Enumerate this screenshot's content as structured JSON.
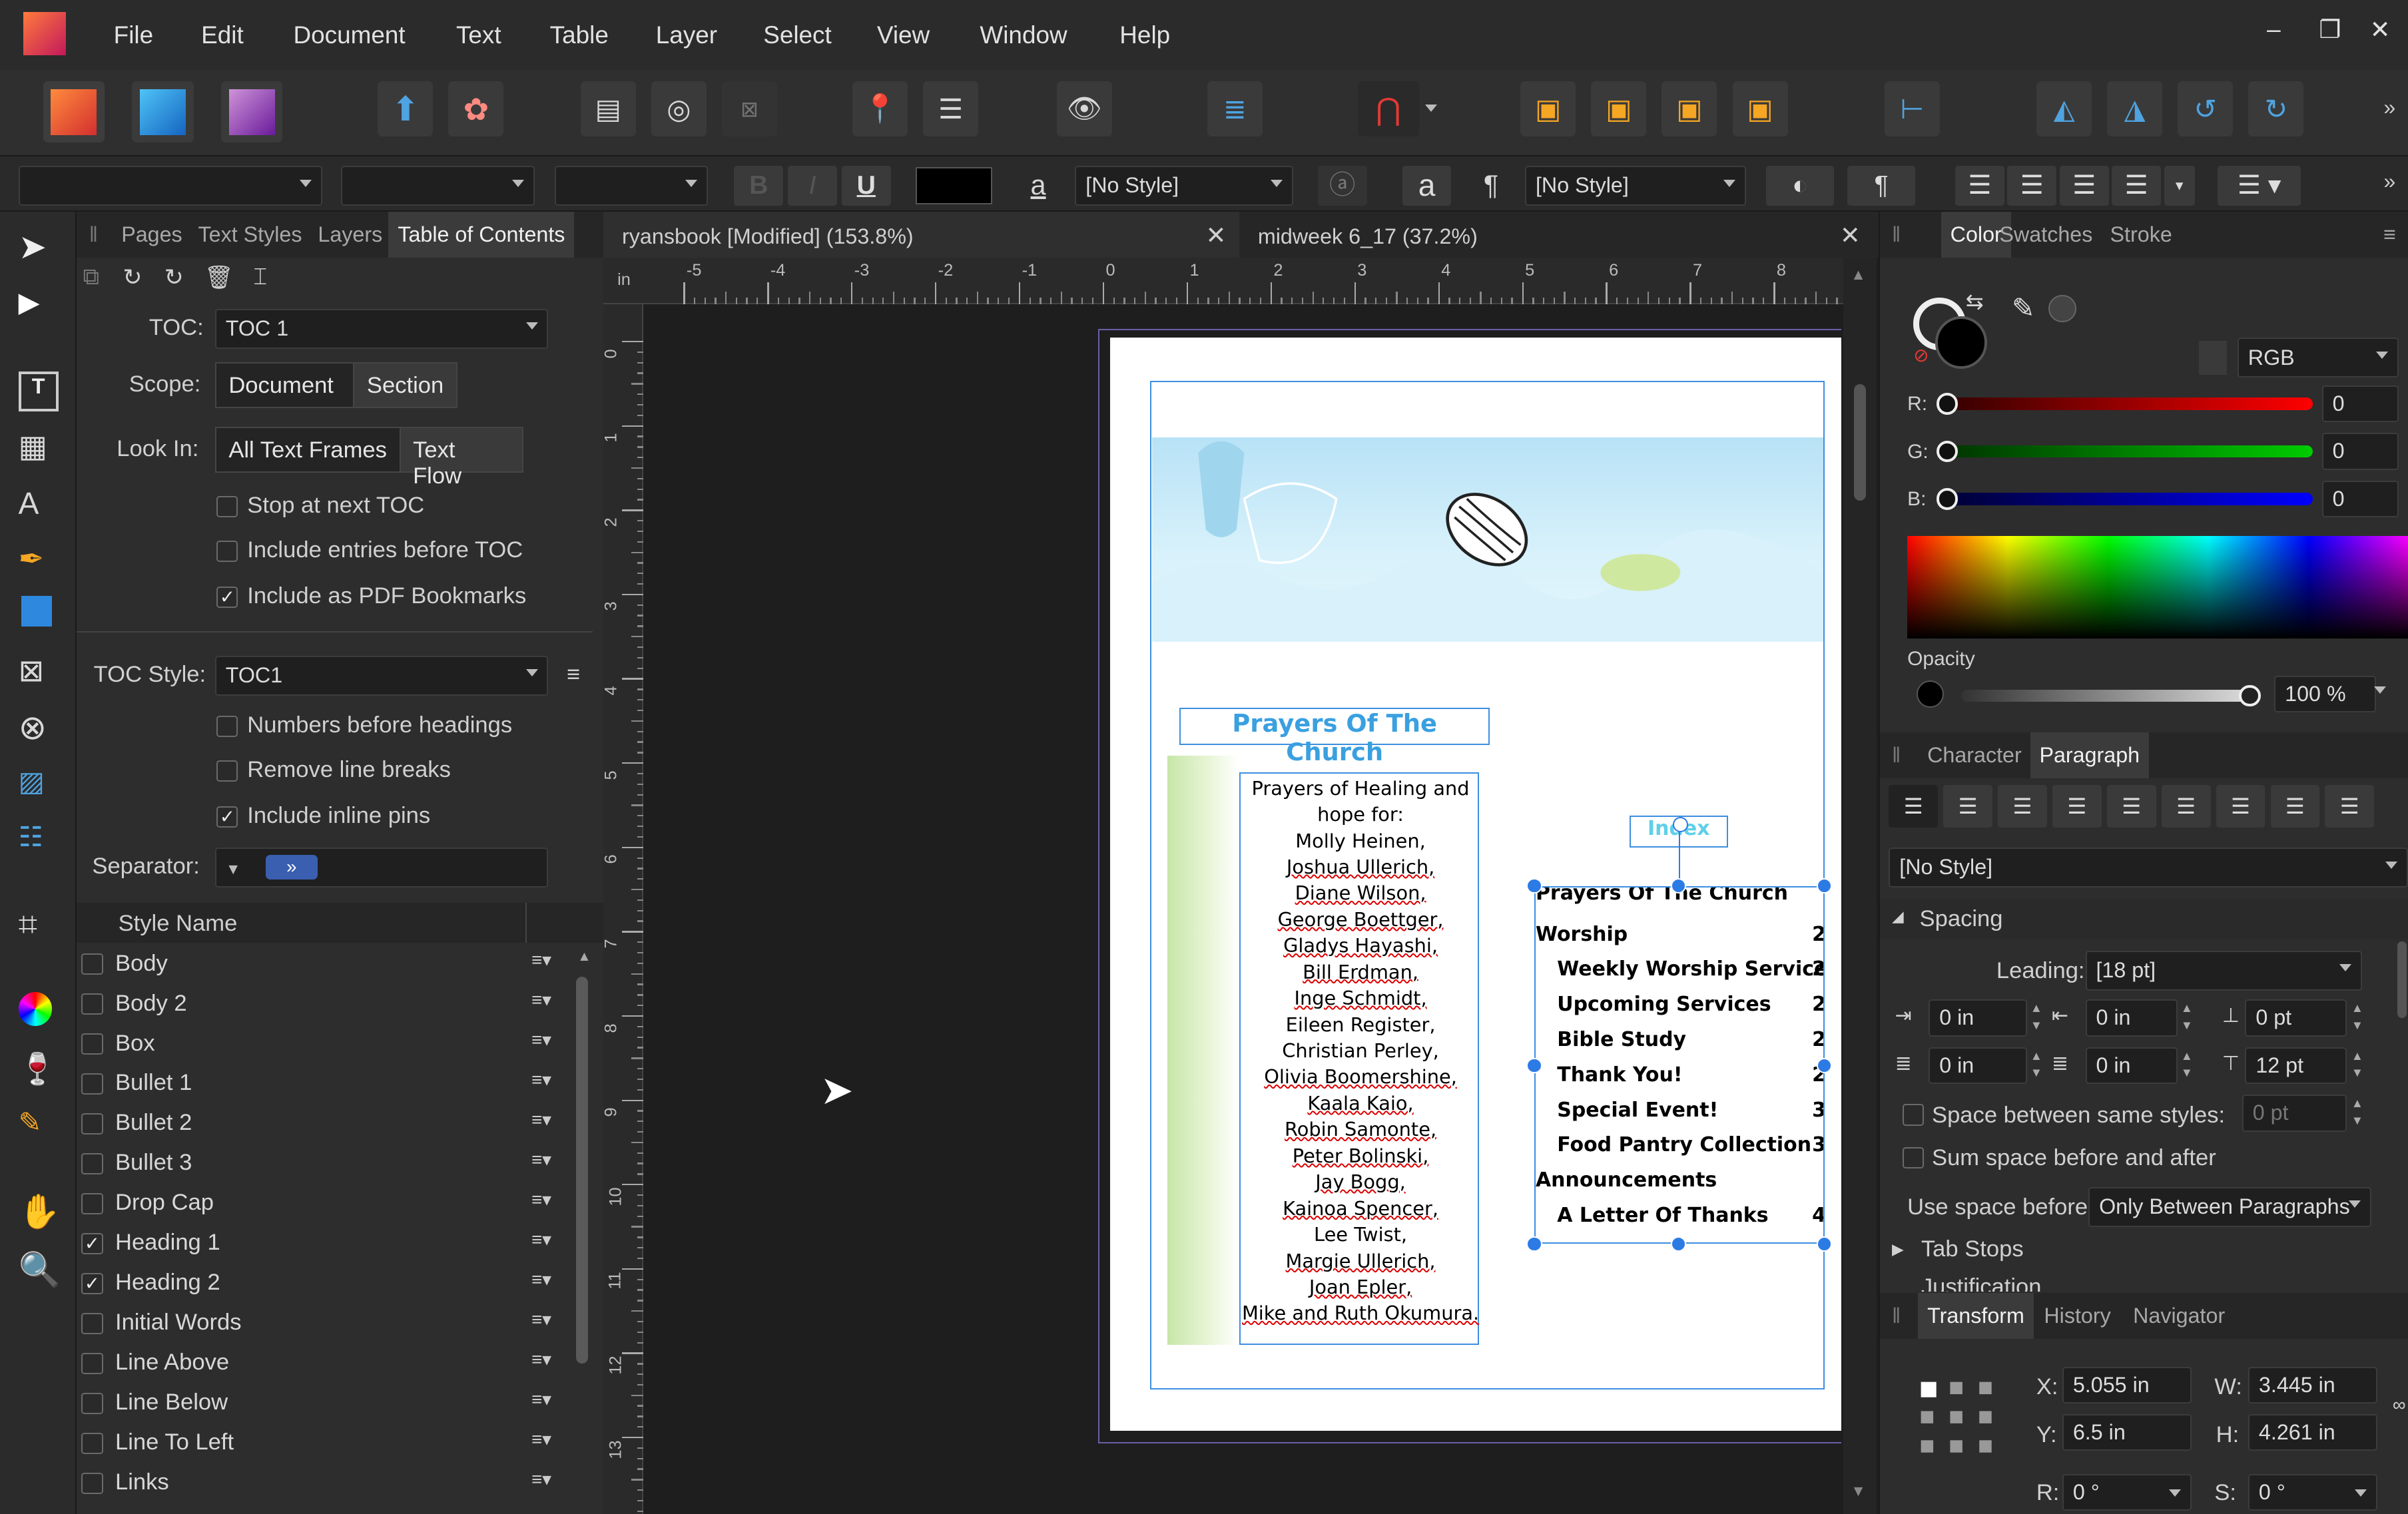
{
  "menu": {
    "items": [
      "File",
      "Edit",
      "Document",
      "Text",
      "Table",
      "Layer",
      "Select",
      "View",
      "Window",
      "Help"
    ]
  },
  "context": {
    "char_style": "[No Style]",
    "para_style": "[No Style]",
    "bold": "B",
    "italic": "I",
    "underline": "U",
    "glyph_a": "a",
    "pilcrow": "¶"
  },
  "left_panel": {
    "tabs": [
      "Pages",
      "Text Styles",
      "Layers",
      "Table of Contents"
    ],
    "toc_label": "TOC:",
    "toc_value": "TOC 1",
    "scope_label": "Scope:",
    "scope_options": [
      "Document",
      "Section"
    ],
    "lookin_label": "Look In:",
    "lookin_options": [
      "All Text Frames",
      "Text Flow"
    ],
    "options": [
      {
        "label": "Stop at next TOC",
        "checked": false
      },
      {
        "label": "Include entries before TOC",
        "checked": false
      },
      {
        "label": "Include as PDF Bookmarks",
        "checked": true
      }
    ],
    "toc_style_label": "TOC Style:",
    "toc_style_value": "TOC1",
    "style_options": [
      {
        "label": "Numbers before headings",
        "checked": false
      },
      {
        "label": "Remove line breaks",
        "checked": false
      },
      {
        "label": "Include inline pins",
        "checked": true
      }
    ],
    "separator_label": "Separator:",
    "separator_value": "»",
    "col_header": "Style Name",
    "styles": [
      {
        "name": "Body",
        "checked": false
      },
      {
        "name": "Body 2",
        "checked": false
      },
      {
        "name": "Box",
        "checked": false
      },
      {
        "name": "Bullet 1",
        "checked": false
      },
      {
        "name": "Bullet 2",
        "checked": false
      },
      {
        "name": "Bullet 3",
        "checked": false
      },
      {
        "name": "Drop Cap",
        "checked": false
      },
      {
        "name": "Heading 1",
        "checked": true
      },
      {
        "name": "Heading 2",
        "checked": true
      },
      {
        "name": "Initial Words",
        "checked": false
      },
      {
        "name": "Line Above",
        "checked": false
      },
      {
        "name": "Line Below",
        "checked": false
      },
      {
        "name": "Line To Left",
        "checked": false
      },
      {
        "name": "Links",
        "checked": false
      }
    ]
  },
  "doc_tabs": [
    "ryansbook [Modified] (153.8%)",
    "midweek 6_17 (37.2%)"
  ],
  "ruler": {
    "unit": "in",
    "h": [
      "-5",
      "-4",
      "-3",
      "-2",
      "-1",
      "0",
      "1",
      "2",
      "3",
      "4",
      "5",
      "6",
      "7",
      "8"
    ],
    "v": [
      "0",
      "1",
      "2",
      "3",
      "4",
      "5",
      "6",
      "7",
      "8",
      "9",
      "10",
      "11",
      "12",
      "13"
    ]
  },
  "page": {
    "heading": "Prayers Of The Church",
    "index_title": "Index",
    "prayers": [
      "Prayers of Healing and",
      "hope for:",
      "Molly Heinen,",
      "Joshua Ullerich,",
      "Diane Wilson,",
      "George Boettger,",
      "Gladys Hayashi,",
      "Bill Erdman,",
      "Inge Schmidt,",
      "Eileen Register,",
      "Christian Perley,",
      "Olivia Boomershine,",
      "Kaala Kaio,",
      "Robin Samonte,",
      "Peter Bolinski,",
      "Jay Bogg,",
      "Kainoa Spencer,",
      "Lee Twist,",
      "Margie Ullerich,",
      "Joan Epler,",
      "Mike and Ruth Okumura."
    ],
    "toc_entries": [
      {
        "text": "Prayers Of The Church",
        "page": "",
        "indent": false
      },
      {
        "text": "Worship",
        "page": "2",
        "indent": false
      },
      {
        "text": "Weekly Worship Services",
        "page": "2",
        "indent": true
      },
      {
        "text": "Upcoming Services",
        "page": "2",
        "indent": true
      },
      {
        "text": "Bible Study",
        "page": "2",
        "indent": true
      },
      {
        "text": "Thank You!",
        "page": "2",
        "indent": true
      },
      {
        "text": "Special Event!",
        "page": "3",
        "indent": true
      },
      {
        "text": "Food Pantry Collection",
        "page": "3",
        "indent": true
      },
      {
        "text": "Announcements",
        "page": "",
        "indent": false
      },
      {
        "text": "A Letter Of Thanks",
        "page": "4",
        "indent": true
      }
    ]
  },
  "color_panel": {
    "tabs": [
      "Color",
      "Swatches",
      "Stroke"
    ],
    "model": "RGB",
    "channels": [
      {
        "label": "R:",
        "value": "0"
      },
      {
        "label": "G:",
        "value": "0"
      },
      {
        "label": "B:",
        "value": "0"
      }
    ],
    "opacity_label": "Opacity",
    "opacity_value": "100 %"
  },
  "para_panel": {
    "tabs": [
      "Character",
      "Paragraph"
    ],
    "style": "[No Style]",
    "spacing_label": "Spacing",
    "leading_label": "Leading:",
    "leading_value": "[18 pt]",
    "fields": [
      "0 in",
      "0 in",
      "0 pt",
      "0 in",
      "0 in",
      "12 pt"
    ],
    "space_same_label": "Space between same styles:",
    "space_same_value": "0 pt",
    "sum_label": "Sum space before and after",
    "use_before_label": "Use space before:",
    "use_before_value": "Only Between Paragraphs",
    "tab_stops": "Tab Stops",
    "justification": "Justification"
  },
  "transform": {
    "tabs": [
      "Transform",
      "History",
      "Navigator"
    ],
    "x_label": "X:",
    "x": "5.055 in",
    "w_label": "W:",
    "w": "3.445 in",
    "y_label": "Y:",
    "y": "6.5 in",
    "h_label": "H:",
    "h": "4.261 in",
    "r_label": "R:",
    "r": "0 °",
    "s_label": "S:",
    "s": "0 °"
  }
}
